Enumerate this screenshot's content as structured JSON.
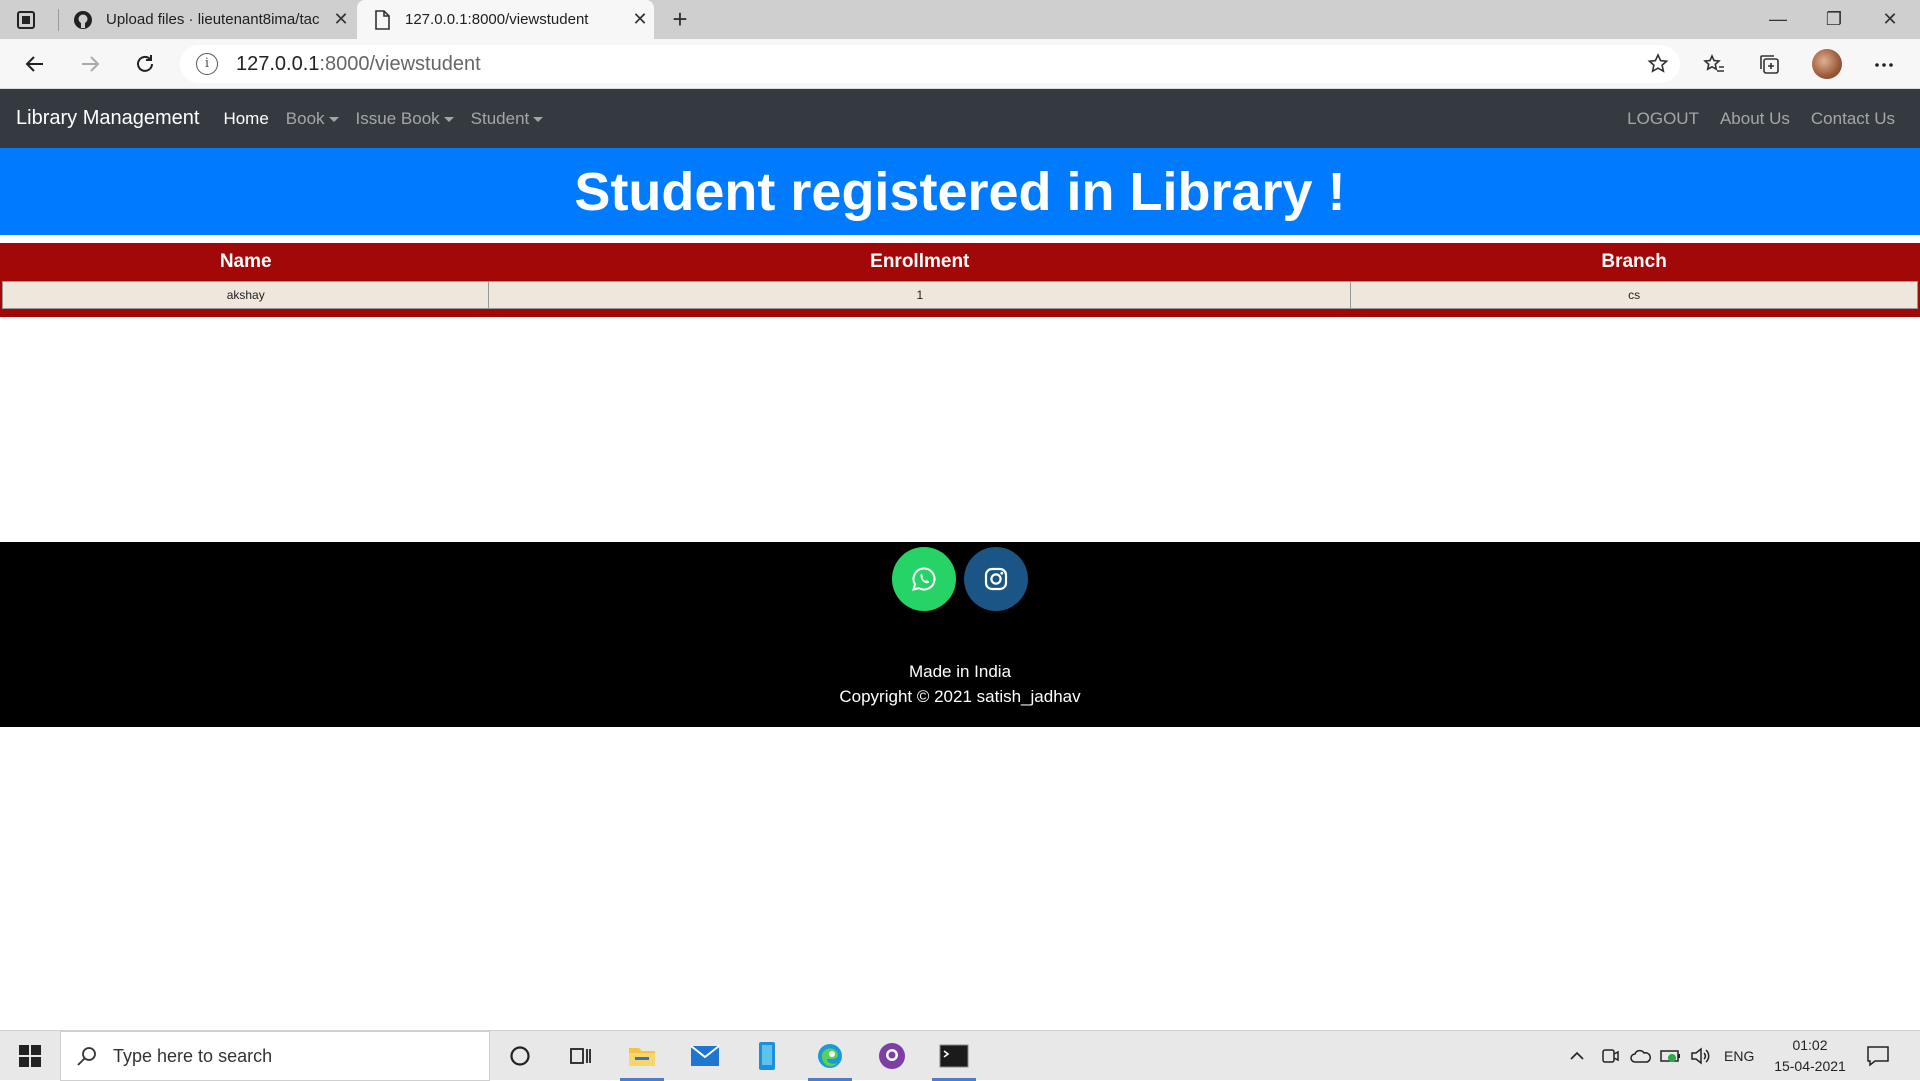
{
  "browser": {
    "tabs": [
      {
        "title": "Upload files · lieutenant8ima/tac",
        "icon": "github-icon",
        "active": false
      },
      {
        "title": "127.0.0.1:8000/viewstudent",
        "icon": "page-icon",
        "active": true
      }
    ],
    "new_tab_label": "+",
    "url_host": "127.0.0.1",
    "url_path": ":8000/viewstudent"
  },
  "navbar": {
    "brand": "Library Management",
    "links": [
      "Home",
      "Book",
      "Issue Book",
      "Student"
    ],
    "right_links": [
      "LOGOUT",
      "About Us",
      "Contact Us"
    ]
  },
  "banner": {
    "title": "Student registered in Library !"
  },
  "table": {
    "headers": [
      "Name",
      "Enrollment",
      "Branch"
    ],
    "rows": [
      [
        "akshay",
        "1",
        "cs"
      ]
    ]
  },
  "footer": {
    "line1": "Made in India",
    "line2": "Copyright © 2021 satish_jadhav",
    "social": [
      "whatsapp-icon",
      "instagram-icon"
    ]
  },
  "taskbar": {
    "search_placeholder": "Type here to search",
    "language": "ENG",
    "time": "01:02",
    "date": "15-04-2021"
  },
  "colors": {
    "navbar": "#343a40",
    "banner": "#007bff",
    "table_bg": "#a30808",
    "row_bg": "#efe6dc",
    "whatsapp": "#25d366",
    "instagram": "#1a5585"
  }
}
